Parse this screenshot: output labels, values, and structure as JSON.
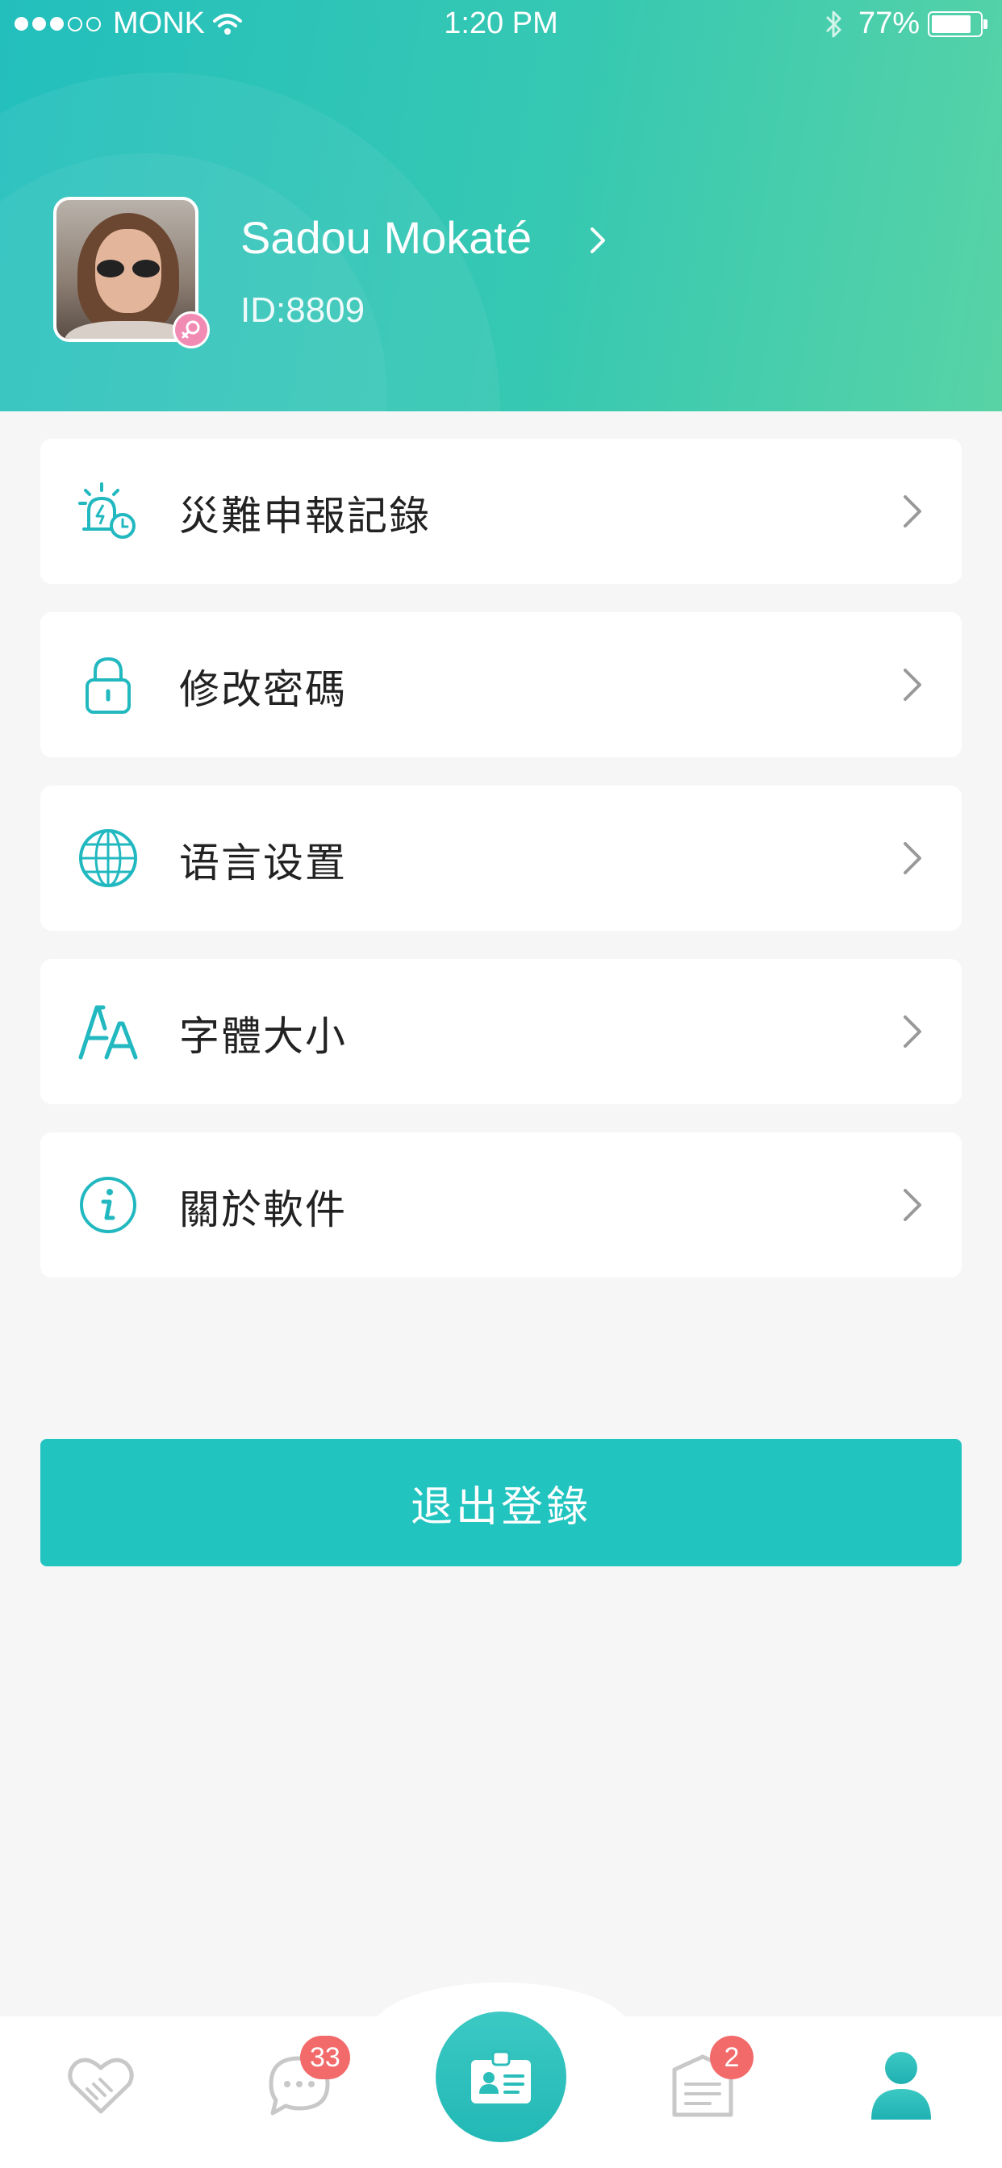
{
  "status_bar": {
    "carrier": "MONK",
    "time": "1:20 PM",
    "battery": "77%"
  },
  "profile": {
    "name": "Sadou Mokaté",
    "id": "ID:8809"
  },
  "menu": {
    "items": [
      {
        "label": "災難申報記錄",
        "icon": "disaster-alarm-icon"
      },
      {
        "label": "修改密碼",
        "icon": "lock-icon"
      },
      {
        "label": "语言设置",
        "icon": "globe-icon"
      },
      {
        "label": "字體大小",
        "icon": "font-size-icon"
      },
      {
        "label": "關於軟件",
        "icon": "info-icon"
      }
    ]
  },
  "logout": {
    "label": "退出登錄"
  },
  "tabbar": {
    "items": [
      {
        "icon": "handshake-icon",
        "badge": ""
      },
      {
        "icon": "chat-icon",
        "badge": "33"
      },
      {
        "icon": "id-card-icon",
        "badge": ""
      },
      {
        "icon": "report-icon",
        "badge": "2"
      },
      {
        "icon": "profile-icon",
        "badge": ""
      }
    ]
  },
  "colors": {
    "accent": "#22c4c0",
    "header_start": "#23bfbd",
    "header_end": "#58d3a6",
    "badge": "#f26a6a",
    "gender_badge": "#f28bb4"
  }
}
